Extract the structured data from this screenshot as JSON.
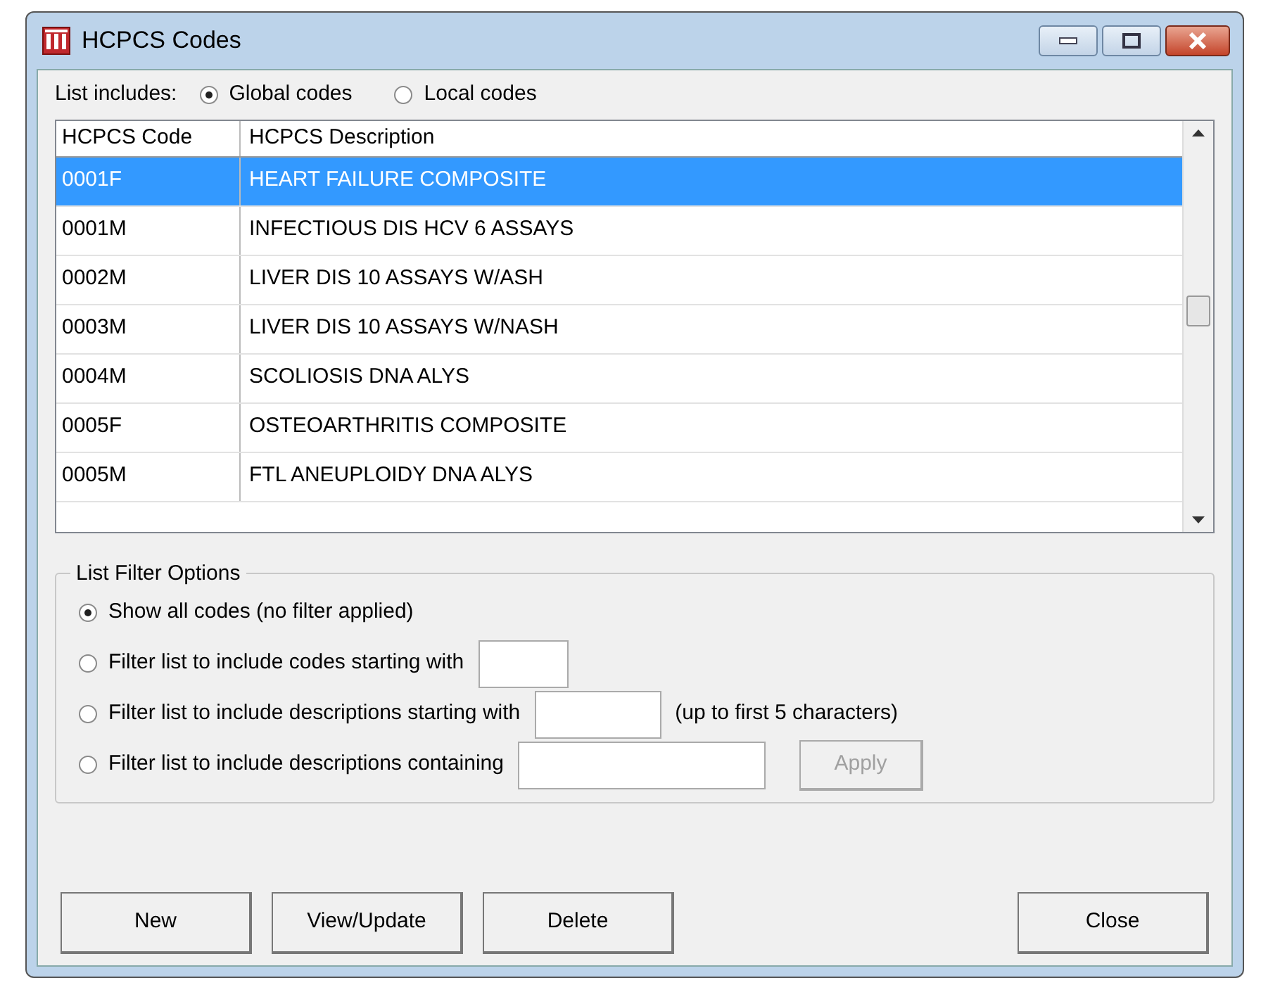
{
  "window": {
    "title": "HCPCS Codes"
  },
  "list_includes": {
    "label": "List includes:",
    "options": [
      {
        "label": "Global codes",
        "selected": true
      },
      {
        "label": "Local codes",
        "selected": false
      }
    ]
  },
  "table": {
    "columns": [
      "HCPCS Code",
      "HCPCS Description"
    ],
    "rows": [
      {
        "code": "0001F",
        "description": "HEART FAILURE COMPOSITE",
        "selected": true
      },
      {
        "code": "0001M",
        "description": "INFECTIOUS DIS HCV 6 ASSAYS",
        "selected": false
      },
      {
        "code": "0002M",
        "description": "LIVER DIS 10 ASSAYS W/ASH",
        "selected": false
      },
      {
        "code": "0003M",
        "description": "LIVER DIS 10 ASSAYS W/NASH",
        "selected": false
      },
      {
        "code": "0004M",
        "description": "SCOLIOSIS DNA ALYS",
        "selected": false
      },
      {
        "code": "0005F",
        "description": "OSTEOARTHRITIS COMPOSITE",
        "selected": false
      },
      {
        "code": "0005M",
        "description": "FTL ANEUPLOIDY DNA ALYS",
        "selected": false
      }
    ]
  },
  "filter": {
    "title": "List Filter Options",
    "options": [
      {
        "kind": "plain",
        "label": "Show all codes (no filter applied)",
        "selected": true
      },
      {
        "kind": "code",
        "label": "Filter list to include codes starting with",
        "selected": false
      },
      {
        "kind": "start",
        "label": "Filter list to include descriptions starting with",
        "selected": false,
        "note": "(up to first 5 characters)"
      },
      {
        "kind": "contains",
        "label": "Filter list to include descriptions containing",
        "selected": false,
        "button": {
          "label": "Apply",
          "disabled": true
        }
      }
    ]
  },
  "buttons_left": [
    "New",
    "View/Update",
    "Delete"
  ],
  "buttons_right": [
    "Close"
  ]
}
